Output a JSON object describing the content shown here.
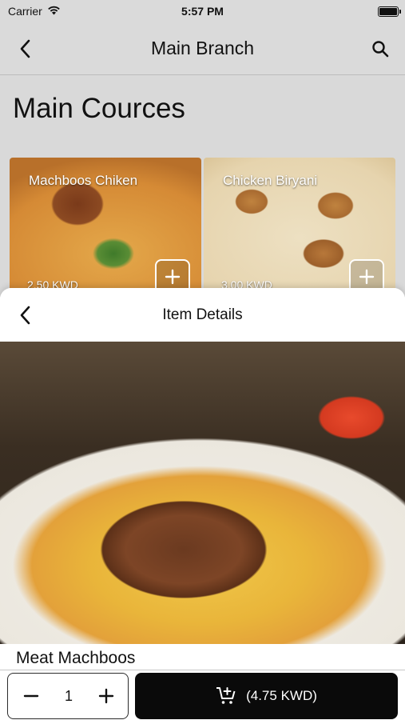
{
  "status_bar": {
    "carrier": "Carrier",
    "time": "5:57 PM",
    "battery_level": 1.0
  },
  "header": {
    "title": "Main Branch",
    "back_icon": "chevron-left-icon",
    "search_icon": "search-icon"
  },
  "section": {
    "title": "Main Cources"
  },
  "cards": [
    {
      "name": "Machboos Chiken",
      "price": "2.50 KWD"
    },
    {
      "name": "Chicken Biryani",
      "price": "3.00 KWD"
    }
  ],
  "sheet": {
    "title": "Item Details",
    "item_name": "Meat Machboos",
    "quantity": "1",
    "add_to_cart_label": "(4.75 KWD)"
  },
  "colors": {
    "background": "#dadada",
    "primary_button": "#0a0a0a"
  }
}
